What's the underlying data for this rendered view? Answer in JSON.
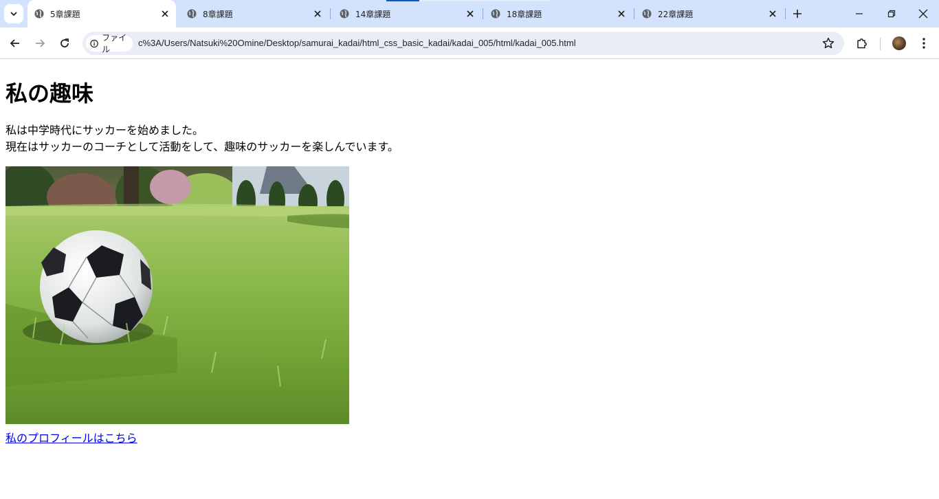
{
  "browser": {
    "tabs": [
      {
        "title": "5章課題",
        "active": true
      },
      {
        "title": "8章課題",
        "active": false
      },
      {
        "title": "14章課題",
        "active": false
      },
      {
        "title": "18章課題",
        "active": false
      },
      {
        "title": "22章課題",
        "active": false
      }
    ],
    "address_bar": {
      "chip_label": "ファイル",
      "url": "c%3A/Users/Natsuki%20Omine/Desktop/samurai_kadai/html_css_basic_kadai/kadai_005/html/kadai_005.html"
    }
  },
  "page": {
    "heading": "私の趣味",
    "paragraph_line1": "私は中学時代にサッカーを始めました。",
    "paragraph_line2": "現在はサッカーのコーチとして活動をして、趣味のサッカーを楽しんでいます。",
    "image_subject": "soccer ball on grass",
    "link_text": "私のプロフィールはこちら"
  },
  "colors": {
    "tabstrip_bg": "#d3e3fd",
    "omnibox_bg": "#e9eef6",
    "link": "#0000ee"
  }
}
